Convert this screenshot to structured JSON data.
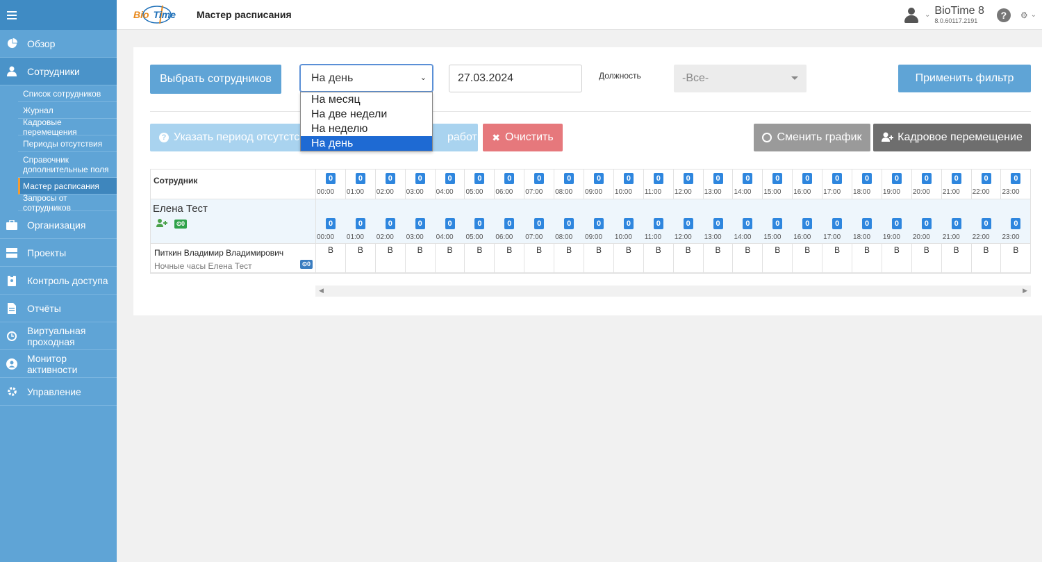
{
  "sidebar": {
    "items": [
      {
        "label": "Обзор",
        "icon": "pie-chart-icon"
      },
      {
        "label": "Сотрудники",
        "icon": "user-icon"
      },
      {
        "label": "Организация",
        "icon": "briefcase-icon"
      },
      {
        "label": "Проекты",
        "icon": "server-icon"
      },
      {
        "label": "Контроль доступа",
        "icon": "badge-icon"
      },
      {
        "label": "Отчёты",
        "icon": "document-icon"
      },
      {
        "label": "Виртуальная проходная",
        "icon": "clock-icon"
      },
      {
        "label": "Монитор активности",
        "icon": "user-circle-icon"
      },
      {
        "label": "Управление",
        "icon": "gear-icon"
      }
    ],
    "sub_items": [
      "Список сотрудников",
      "Журнал",
      "Кадровые перемещения",
      "Периоды отсутствия",
      "Справочник дополнительные поля",
      "Мастер расписания",
      "Запросы от сотрудников"
    ]
  },
  "header": {
    "logo_bio": "Bio",
    "logo_time": "Time",
    "page_title": "Мастер расписания",
    "app_name": "BioTime 8",
    "app_version": "8.0.60117.2191"
  },
  "toolbar": {
    "select_employees": "Выбрать сотрудников",
    "period_value": "На день",
    "period_options": [
      "На месяц",
      "На две недели",
      "На неделю",
      "На день"
    ],
    "date_value": "27.03.2024",
    "position_label": "Должность",
    "position_value": "-Все-",
    "apply_filter": "Применить фильтр",
    "absence_period": "Указать период отсутстс",
    "absence_period_tail": "работы",
    "clear": "Очистить",
    "change_schedule": "Сменить график",
    "transfer": "Кадровое перемещение"
  },
  "grid": {
    "employee_header": "Сотрудник",
    "hours": [
      "00:00",
      "01:00",
      "02:00",
      "03:00",
      "04:00",
      "05:00",
      "06:00",
      "07:00",
      "08:00",
      "09:00",
      "10:00",
      "11:00",
      "12:00",
      "13:00",
      "14:00",
      "15:00",
      "16:00",
      "17:00",
      "18:00",
      "19:00",
      "20:00",
      "21:00",
      "22:00",
      "23:00"
    ],
    "header_counts": [
      "0",
      "0",
      "0",
      "0",
      "0",
      "0",
      "0",
      "0",
      "0",
      "0",
      "0",
      "0",
      "0",
      "0",
      "0",
      "0",
      "0",
      "0",
      "0",
      "0",
      "0",
      "0",
      "0",
      "0"
    ],
    "group": {
      "name": "Елена Тест",
      "badge": "0",
      "counts": [
        "0",
        "0",
        "0",
        "0",
        "0",
        "0",
        "0",
        "0",
        "0",
        "0",
        "0",
        "0",
        "0",
        "0",
        "0",
        "0",
        "0",
        "0",
        "0",
        "0",
        "0",
        "0",
        "0",
        "0"
      ]
    },
    "employee": {
      "name": "Питкин Владимир Владимирович",
      "schedule": "Ночные часы Елена Тест",
      "badge": "0",
      "cells": [
        "В",
        "В",
        "В",
        "В",
        "В",
        "В",
        "В",
        "В",
        "В",
        "В",
        "В",
        "В",
        "В",
        "В",
        "В",
        "В",
        "В",
        "В",
        "В",
        "В",
        "В",
        "В",
        "В",
        "В"
      ]
    }
  },
  "colors": {
    "sidebar": "#5fa4d6",
    "primary_button": "#5fa4d6",
    "danger_button": "#e6787c",
    "badge": "#2e86de",
    "selected_option": "#1e6ad3"
  }
}
